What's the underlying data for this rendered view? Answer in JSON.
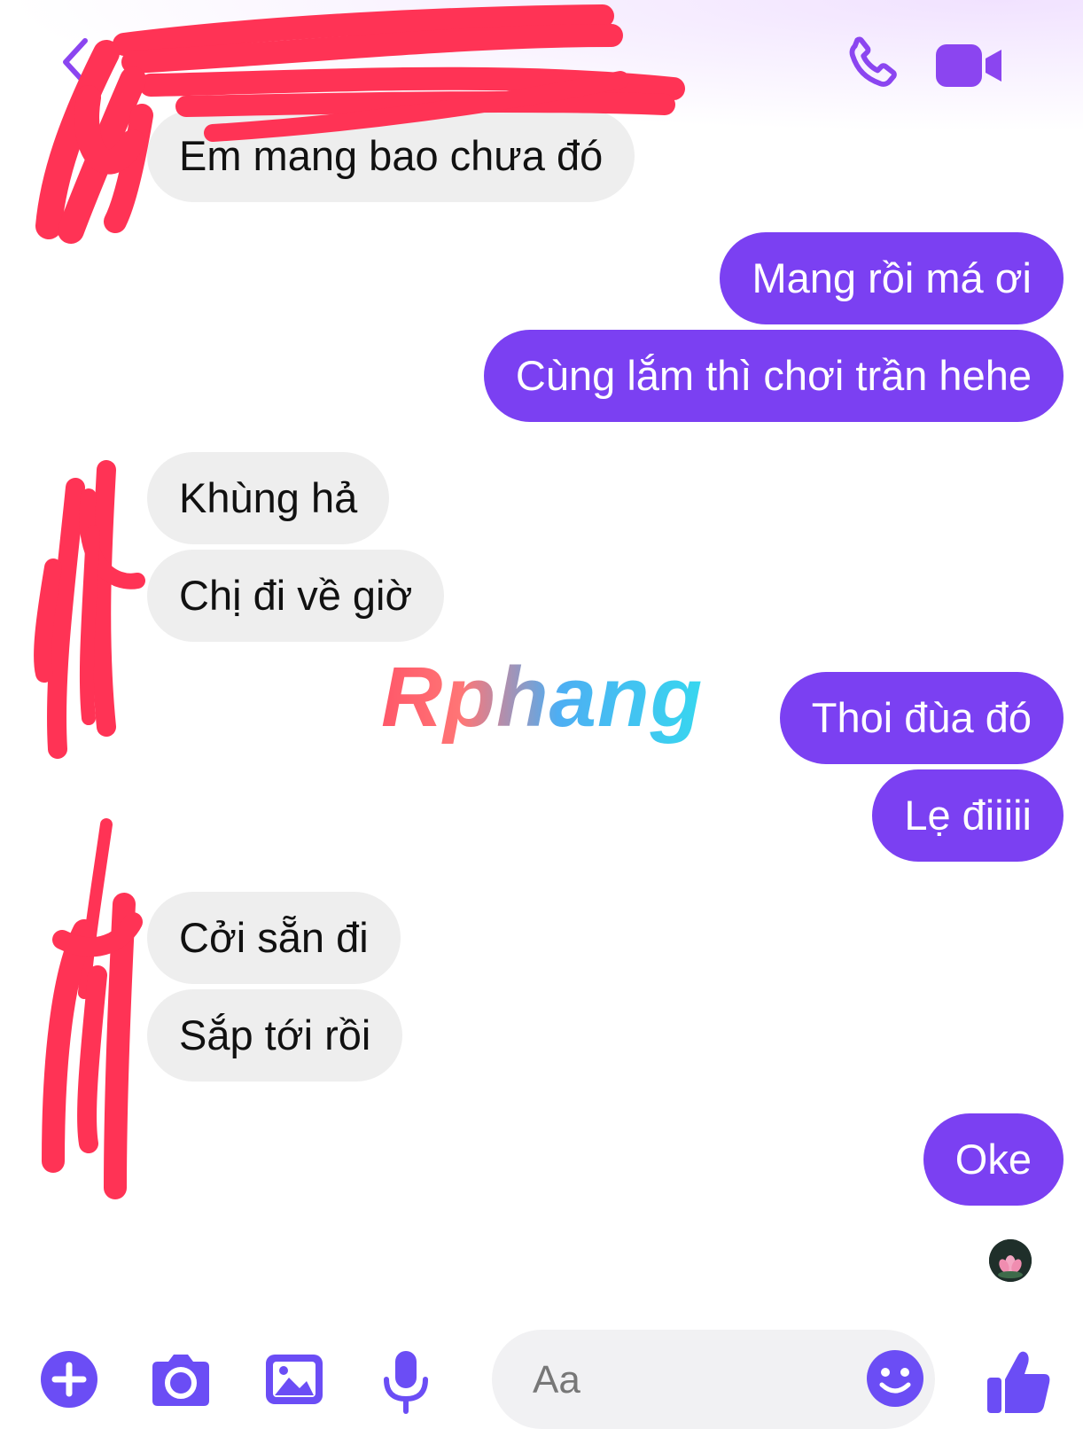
{
  "header": {
    "back_icon": "chevron-left-icon",
    "call_icon": "phone-icon",
    "video_icon": "video-camera-icon",
    "accent_color": "#7b40f2"
  },
  "messages": [
    {
      "from": "them",
      "text": "Em mang bao chưa đó"
    },
    {
      "from": "me",
      "text": "Mang rồi má ơi"
    },
    {
      "from": "me",
      "text": "Cùng lắm thì chơi trần hehe"
    },
    {
      "from": "them",
      "text": "Khùng hả"
    },
    {
      "from": "them",
      "text": "Chị đi về giờ"
    },
    {
      "from": "me",
      "text": "Thoi đùa đó"
    },
    {
      "from": "me",
      "text": "Lẹ điiiii"
    },
    {
      "from": "them",
      "text": "Cởi sẵn đi"
    },
    {
      "from": "them",
      "text": "Sắp tới rồi"
    },
    {
      "from": "me",
      "text": "Oke"
    }
  ],
  "watermark": "Rphang",
  "composer": {
    "placeholder": "Aa",
    "add_icon": "plus-circle-icon",
    "camera_icon": "camera-icon",
    "image_icon": "image-icon",
    "mic_icon": "microphone-icon",
    "emoji_icon": "smiley-icon",
    "like_icon": "thumbs-up-icon"
  },
  "colors": {
    "outgoing_bubble": "#7b40f2",
    "incoming_bubble": "#eeeeee",
    "toolbar_icon": "#6b4df5",
    "redaction": "#ff3355"
  }
}
